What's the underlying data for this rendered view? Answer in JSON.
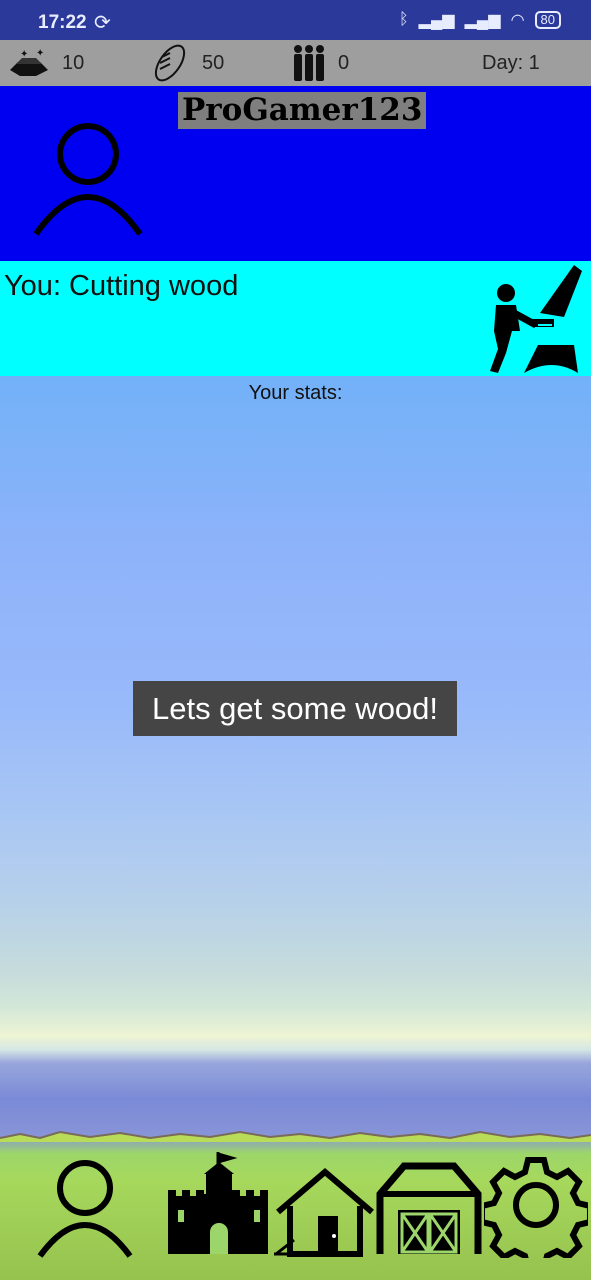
{
  "status_bar": {
    "time": "17:22",
    "battery": "80"
  },
  "resources": {
    "gold": "10",
    "food": "50",
    "population": "0",
    "day_label": "Day: 1"
  },
  "profile": {
    "player_name": "ProGamer123"
  },
  "activity": {
    "text": "You: Cutting wood"
  },
  "stats": {
    "label": "Your stats:"
  },
  "toast": {
    "message": "Lets get some wood!"
  },
  "icons": {
    "resources": [
      "gold-icon",
      "bread-icon",
      "people-icon"
    ],
    "navigation": [
      "profile-nav-icon",
      "castle-nav-icon",
      "house-nav-icon",
      "barn-nav-icon",
      "settings-nav-icon"
    ]
  },
  "colors": {
    "status_bar": "#2b3a9a",
    "resource_bar": "#9e9e9e",
    "profile_panel": "#0000f0",
    "activity_panel": "#00ffff",
    "toast": "#454545"
  }
}
